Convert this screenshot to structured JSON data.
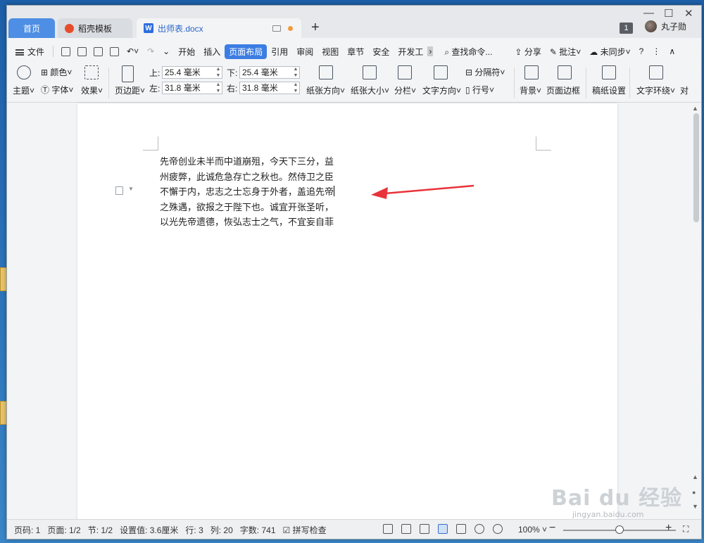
{
  "tabs": {
    "home": "首页",
    "template": "稻壳模板",
    "document": "出师表.docx",
    "new_tab": "+",
    "window_count": "1",
    "username": "丸子勋"
  },
  "menu": {
    "file": "文件",
    "items": [
      "开始",
      "插入",
      "页面布局",
      "引用",
      "审阅",
      "视图",
      "章节",
      "安全",
      "开发工"
    ],
    "active": "页面布局",
    "search": "查找命令...",
    "share": "分享",
    "comment": "批注",
    "sync": "未同步",
    "help": "?",
    "more": "⋮",
    "collapse": "∧"
  },
  "ribbon": {
    "theme": "主题",
    "colors": "颜色",
    "font": "字体",
    "effects": "效果",
    "margins": "页边距",
    "top_label": "上:",
    "top_value": "25.4 毫米",
    "bottom_label": "下:",
    "bottom_value": "25.4 毫米",
    "left_label": "左:",
    "left_value": "31.8 毫米",
    "right_label": "右:",
    "right_value": "31.8 毫米",
    "orientation": "纸张方向",
    "size": "纸张大小",
    "columns": "分栏",
    "text_direction": "文字方向",
    "breaks": "分隔符",
    "line_numbers": "行号",
    "background": "背景",
    "page_border": "页面边框",
    "manuscript": "稿纸设置",
    "wrap_text": "文字环绕",
    "align": "对"
  },
  "document": {
    "lines": [
      "先帝创业未半而中道崩殂，今天下三分，益",
      "州疲弊，此诚危急存亡之秋也。然侍卫之臣",
      "不懈于内，忠志之士忘身于外者，盖追先帝",
      "之殊遇，欲报之于陛下也。诚宜开张圣听，",
      "以光先帝遗德，恢弘志士之气，不宜妄自菲"
    ],
    "caret_line": 3
  },
  "status": {
    "page_num": "页码: 1",
    "pages": "页面: 1/2",
    "section": "节: 1/2",
    "setting": "设置值: 3.6厘米",
    "row": "行: 3",
    "col": "列: 20",
    "words": "字数: 741",
    "spellcheck": "拼写检查",
    "zoom": "100%",
    "zoom_minus": "−",
    "zoom_plus": "+",
    "zoom_level": 0.5
  },
  "watermark": {
    "brand": "Bai du 经验",
    "url": "jingyan.baidu.com"
  },
  "colors": {
    "accent": "#3b7de3",
    "arrow": "#e8333a"
  }
}
